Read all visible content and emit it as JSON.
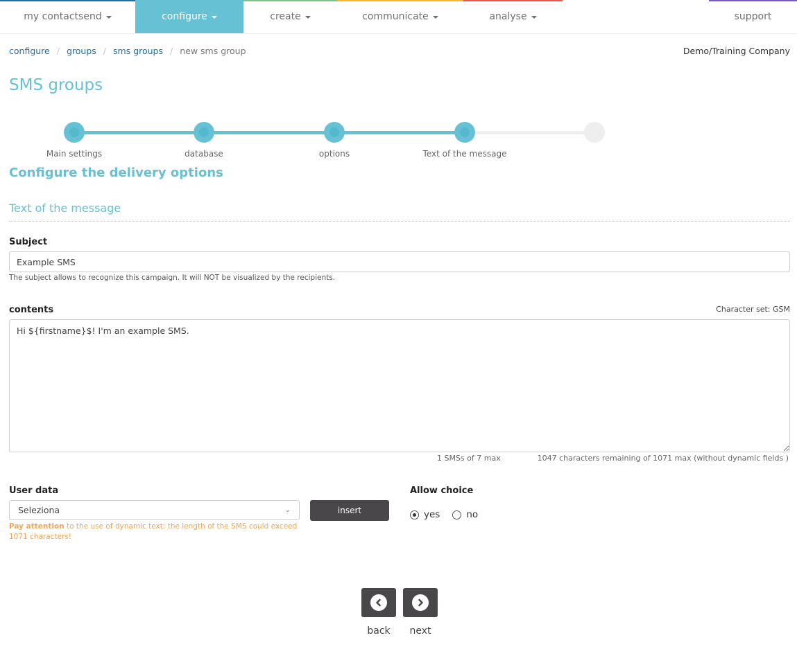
{
  "nav": {
    "items": [
      {
        "label": "my contactsend",
        "color": "#1f6fa8",
        "has_caret": true
      },
      {
        "label": "configure",
        "color": "#66c1d4",
        "has_caret": true,
        "active": true
      },
      {
        "label": "create",
        "color": "#7dc383",
        "has_caret": true
      },
      {
        "label": "communicate",
        "color": "#f7b733",
        "has_caret": true
      },
      {
        "label": "analyse",
        "color": "#ef5350",
        "has_caret": true
      }
    ],
    "support": {
      "label": "support",
      "color": "#7e57c2"
    }
  },
  "breadcrumb": [
    {
      "label": "configure"
    },
    {
      "label": "groups"
    },
    {
      "label": "sms groups"
    },
    {
      "label": "new sms group"
    }
  ],
  "company": "Demo/Training Company",
  "page_title": "SMS groups",
  "stepper": {
    "steps": [
      {
        "label": "Main settings",
        "done": true
      },
      {
        "label": "database",
        "done": true
      },
      {
        "label": "options",
        "done": true
      },
      {
        "label": "Text of the message",
        "done": true
      },
      {
        "label": "",
        "done": false
      }
    ],
    "accent": "#66c1d4"
  },
  "section_title": "Configure the delivery options",
  "subsection_title": "Text of the message",
  "subject": {
    "label": "Subject",
    "value": "Example SMS",
    "help": "The subject allows to recognize this campaign. It will NOT be visualized by the recipients."
  },
  "contents": {
    "label": "contents",
    "charset": "Character set: GSM",
    "value": "Hi ${firstname}$! I'm an example SMS.",
    "sms_count": "1 SMSs of 7 max",
    "chars_remaining": "1047 characters remaining of 1071 max (without dynamic fields )"
  },
  "user_data": {
    "label": "User data",
    "selected": "Seleziona",
    "insert_label": "insert",
    "warning_bold": "Pay attention",
    "warning_text": " to the use of dynamic text: the length of the SMS could exceed 1071 characters!"
  },
  "allow_choice": {
    "label": "Allow choice",
    "options": [
      {
        "label": "yes",
        "checked": true
      },
      {
        "label": "no",
        "checked": false
      }
    ]
  },
  "footer": {
    "back_label": "back",
    "next_label": "next"
  }
}
